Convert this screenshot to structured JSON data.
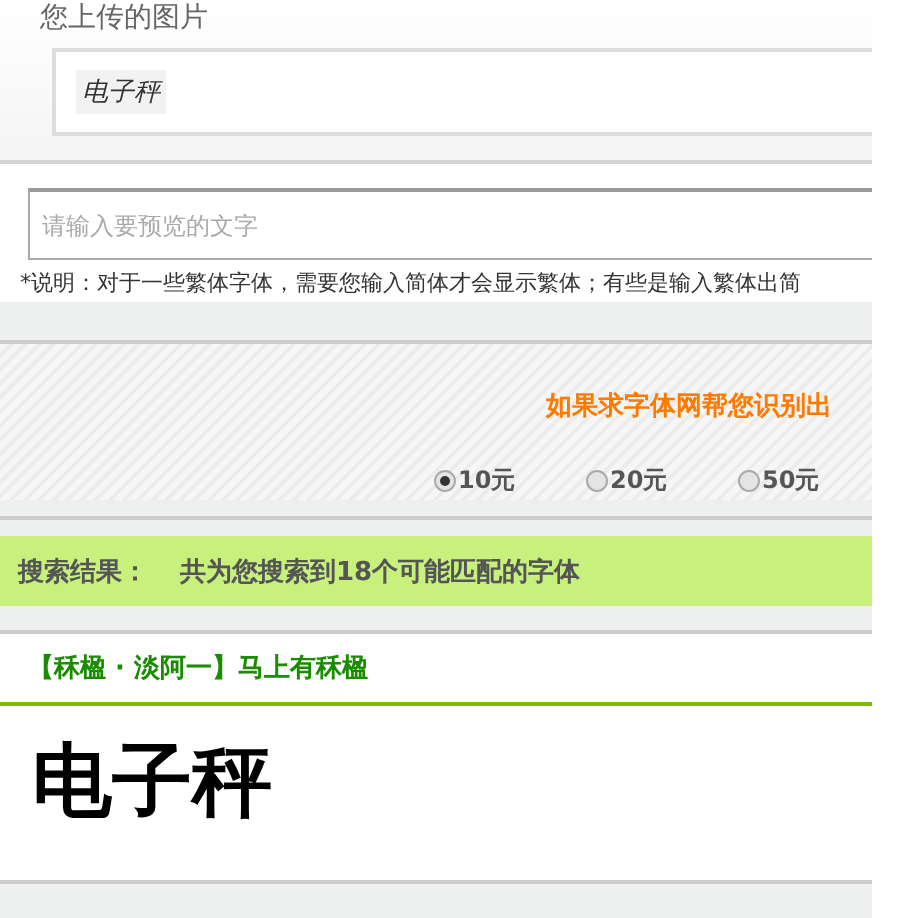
{
  "upload": {
    "title": "您上传的图片",
    "image_text": "电子秤"
  },
  "preview_input": {
    "placeholder": "请输入要预览的文字"
  },
  "note": "*说明：对于一些繁体字体，需要您输入简体才会显示繁体；有些是输入繁体出简",
  "reward": {
    "prompt": "如果求字体网帮您识别出",
    "options": [
      {
        "label": "10元",
        "selected": true
      },
      {
        "label": "20元",
        "selected": false
      },
      {
        "label": "50元",
        "selected": false
      }
    ]
  },
  "results": {
    "label": "搜索结果：",
    "summary": "共为您搜索到18个可能匹配的字体"
  },
  "fonts": [
    {
      "name": "【秝楹 · 淡阿一】马上有秝楹",
      "preview": "电子秤"
    }
  ]
}
